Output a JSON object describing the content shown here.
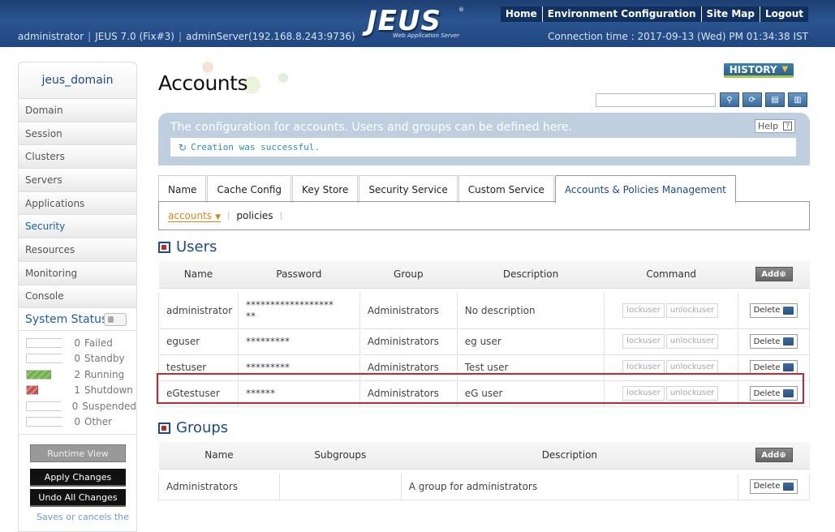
{
  "header": {
    "logo_text": "JEUS",
    "logo_reg": "®",
    "logo_sub": "Web Application Server",
    "nav": [
      "Home",
      "Environment Configuration",
      "Site Map",
      "Logout"
    ],
    "user": "administrator",
    "version": "JEUS 7.0 (Fix#3)",
    "server": "adminServer(192.168.8.243:9736)",
    "connection_time": "Connection time : 2017-09-13 (Wed) PM 01:34:38 IST"
  },
  "sidebar": {
    "domain": "jeus_domain",
    "items": [
      "Domain",
      "Session",
      "Clusters",
      "Servers",
      "Applications",
      "Security",
      "Resources",
      "Monitoring",
      "Console"
    ],
    "active_item": "Security",
    "status_title": "System Status",
    "status": [
      {
        "count": "0",
        "label": "Failed"
      },
      {
        "count": "0",
        "label": "Standby"
      },
      {
        "count": "2",
        "label": "Running"
      },
      {
        "count": "1",
        "label": "Shutdown"
      },
      {
        "count": "0",
        "label": "Suspended"
      },
      {
        "count": "0",
        "label": "Other"
      }
    ],
    "runtime_view": "Runtime View",
    "apply_changes": "Apply Changes",
    "undo_changes": "Undo All Changes",
    "save_note": "Saves or cancels the"
  },
  "main": {
    "title": "Accounts",
    "history_label": "HISTORY",
    "description": "The configuration for accounts. Users and groups can be defined here.",
    "help_label": "Help",
    "message": "Creation was successful.",
    "tabs": [
      "Name",
      "Cache Config",
      "Key Store",
      "Security Service",
      "Custom Service",
      "Accounts & Policies Management"
    ],
    "subtabs": [
      "accounts",
      "policies"
    ],
    "users": {
      "title": "Users",
      "headers": [
        "Name",
        "Password",
        "Group",
        "Description",
        "Command"
      ],
      "add_label": "Add",
      "rows": [
        {
          "name": "administrator",
          "password": "******************\n**",
          "group": "Administrators",
          "description": "No description"
        },
        {
          "name": "eguser",
          "password": "*********",
          "group": "Administrators",
          "description": "eg user"
        },
        {
          "name": "testuser",
          "password": "*********",
          "group": "Administrators",
          "description": "Test user"
        },
        {
          "name": "eGtestuser",
          "password": "******",
          "group": "Administrators",
          "description": "eG user"
        }
      ],
      "lock_label": "lockuser",
      "unlock_label": "unlockuser",
      "delete_label": "Delete"
    },
    "groups": {
      "title": "Groups",
      "headers": [
        "Name",
        "Subgroups",
        "Description"
      ],
      "add_label": "Add",
      "rows": [
        {
          "name": "Administrators",
          "subgroups": "",
          "description": "A group for administrators"
        }
      ],
      "delete_label": "Delete"
    }
  }
}
